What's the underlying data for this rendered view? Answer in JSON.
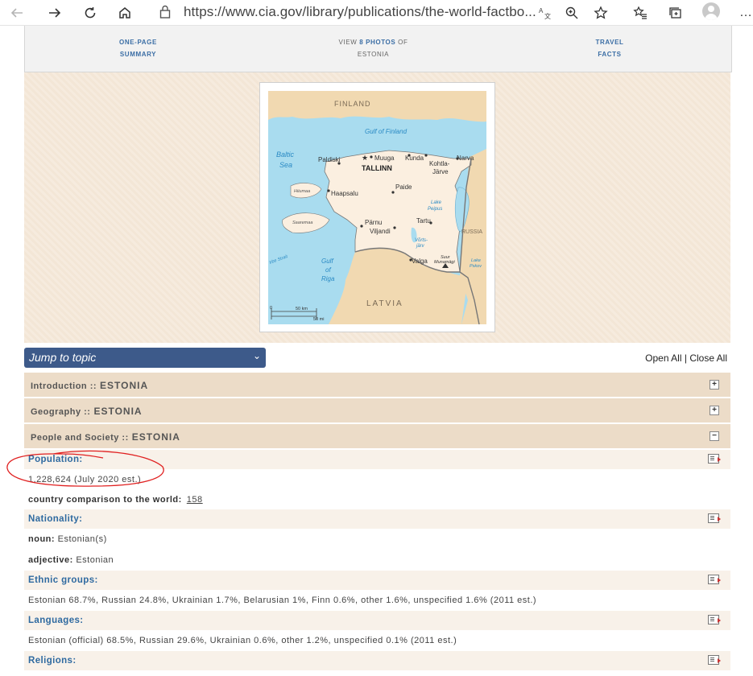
{
  "browser": {
    "url": "https://www.cia.gov/library/publications/the-world-factbo..."
  },
  "topnav": {
    "summary_line1": "ONE-PAGE",
    "summary_line2": "SUMMARY",
    "photos_prefix": "VIEW ",
    "photos_count": "8 PHOTOS",
    "photos_suffix": " OF",
    "photos_country": "ESTONIA",
    "travel_line1": "TRAVEL",
    "travel_line2": "FACTS"
  },
  "map": {
    "labels": {
      "finland": "FINLAND",
      "gulf_finland": "Gulf of Finland",
      "baltic1": "Baltic",
      "baltic2": "Sea",
      "paldiski": "Paldiski",
      "muuga": "Muuga",
      "kunda": "Kunda",
      "narva": "Narva",
      "tallinn": "TALLINN",
      "kohtla1": "Kohtla-",
      "kohtla2": "Järve",
      "haapsalu": "Haapsalu",
      "paide": "Paide",
      "hiiumaa": "Hiiumaa",
      "saaremaa": "Saaremaa",
      "parnu": "Pärnu",
      "viljandi": "Viljandi",
      "tartu": "Tartu",
      "lake_peipus1": "Lake",
      "lake_peipus2": "Peipus",
      "russia": "RUSSIA",
      "vortsjarv1": "Võrts-",
      "vortsjarv2": "järv",
      "gulf_riga1": "Gulf",
      "gulf_riga2": "of",
      "gulf_riga3": "Riga",
      "irbe": "Irbe Strait",
      "valga": "Valga",
      "suur1": "Suur",
      "suur2": "Munamägi",
      "lake_pskov1": "Lake",
      "lake_pskov2": "Pskov",
      "latvia": "LATVIA",
      "scale_km": "50 km",
      "scale_mi": "50 mi",
      "scale_zero": "0"
    }
  },
  "jump": {
    "label": "Jump to topic"
  },
  "openclose": {
    "open": "Open All",
    "sep": " | ",
    "close": "Close All"
  },
  "sections": [
    {
      "title": "Introduction ::",
      "country": "ESTONIA",
      "toggle": "+"
    },
    {
      "title": "Geography ::",
      "country": "ESTONIA",
      "toggle": "+"
    },
    {
      "title": "People and Society ::",
      "country": "ESTONIA",
      "toggle": "−"
    }
  ],
  "fields": {
    "population": {
      "label": "Population:",
      "value": "1,228,624 (July 2020 est.)",
      "comparison_label": "country comparison to the world:",
      "comparison_rank": "158"
    },
    "nationality": {
      "label": "Nationality:",
      "noun_label": "noun:",
      "noun": "Estonian(s)",
      "adj_label": "adjective:",
      "adj": "Estonian"
    },
    "ethnic": {
      "label": "Ethnic groups:",
      "value": "Estonian 68.7%, Russian 24.8%, Ukrainian 1.7%, Belarusian 1%, Finn 0.6%, other 1.6%, unspecified 1.6% (2011 est.)"
    },
    "languages": {
      "label": "Languages:",
      "value": "Estonian (official) 68.5%, Russian 29.6%, Ukrainian 0.6%, other 1.2%, unspecified 0.1% (2011 est.)"
    },
    "religions": {
      "label": "Religions:"
    }
  },
  "colors": {
    "accent_blue": "#2f6aa0",
    "section_bg": "#ecdcc8",
    "jump_bg": "#3d5a8a",
    "annotation_red": "#e02020"
  }
}
